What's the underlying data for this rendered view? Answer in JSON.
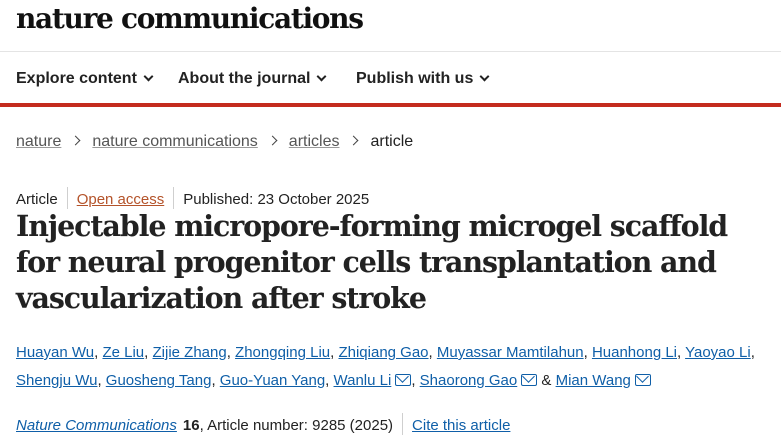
{
  "site": {
    "logo": "nature communications"
  },
  "nav": {
    "items": [
      {
        "label": "Explore content"
      },
      {
        "label": "About the journal"
      },
      {
        "label": "Publish with us"
      }
    ]
  },
  "breadcrumb": {
    "items": [
      "nature",
      "nature communications",
      "articles"
    ],
    "current": "article"
  },
  "meta": {
    "type": "Article",
    "access": "Open access",
    "published": "Published: 23 October 2025"
  },
  "article": {
    "title": "Injectable micropore-forming microgel scaffold for neural progenitor cells transplantation and vascularization after stroke"
  },
  "authors": {
    "list": [
      "Huayan Wu",
      "Ze Liu",
      "Zijie Zhang",
      "Zhongqing Liu",
      "Zhiqiang Gao",
      "Muyassar Mamtilahun",
      "Huanhong Li",
      "Yaoyao Li",
      "Shengju Wu",
      "Guosheng Tang",
      "Guo-Yuan Yang",
      "Wanlu Li",
      "Shaorong Gao",
      "Mian Wang"
    ],
    "separator": ", ",
    "conjunction": " & "
  },
  "citation": {
    "journal": "Nature Communications",
    "volume": "16",
    "details": ", Article number: 9285 (2025)",
    "cite_label": "Cite this article"
  },
  "colors": {
    "accent_red": "#c42b1e",
    "link_blue": "#0f5fa8",
    "open_access": "#b4532a"
  }
}
